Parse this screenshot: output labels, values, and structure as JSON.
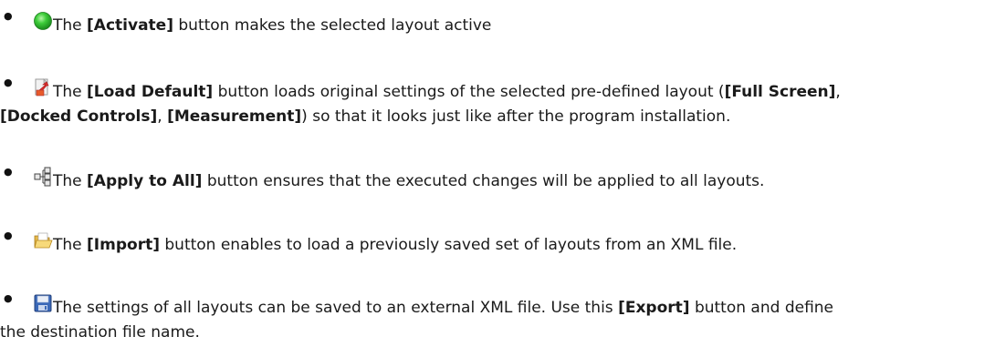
{
  "items": [
    {
      "icon": "green-circle-icon",
      "before": "The ",
      "bold": "[Activate]",
      "after": " button makes the selected layout active"
    },
    {
      "icon": "load-default-icon",
      "before": "The ",
      "bold": "[Load Default]",
      "after": " button loads original settings of the selected pre-defined layout (",
      "bold2": "[Full Screen]",
      "after2": ",",
      "line2_bold1": "[Docked Controls]",
      "line2_mid": ", ",
      "line2_bold2": "[Measurement]",
      "line2_after": ") so that it looks just like after the program installation."
    },
    {
      "icon": "apply-to-all-icon",
      "before": "The ",
      "bold": "[Apply to All]",
      "after": " button ensures that the executed changes will be applied to all layouts."
    },
    {
      "icon": "folder-open-icon",
      "before": "The ",
      "bold": "[Import]",
      "after": " button enables to load a previously saved set of layouts from an XML file."
    },
    {
      "icon": "floppy-disk-icon",
      "before": "The settings of all layouts can be saved to an external XML file. Use this ",
      "bold": "[Export]",
      "after": " button and define",
      "line2": "the destination file name."
    }
  ]
}
